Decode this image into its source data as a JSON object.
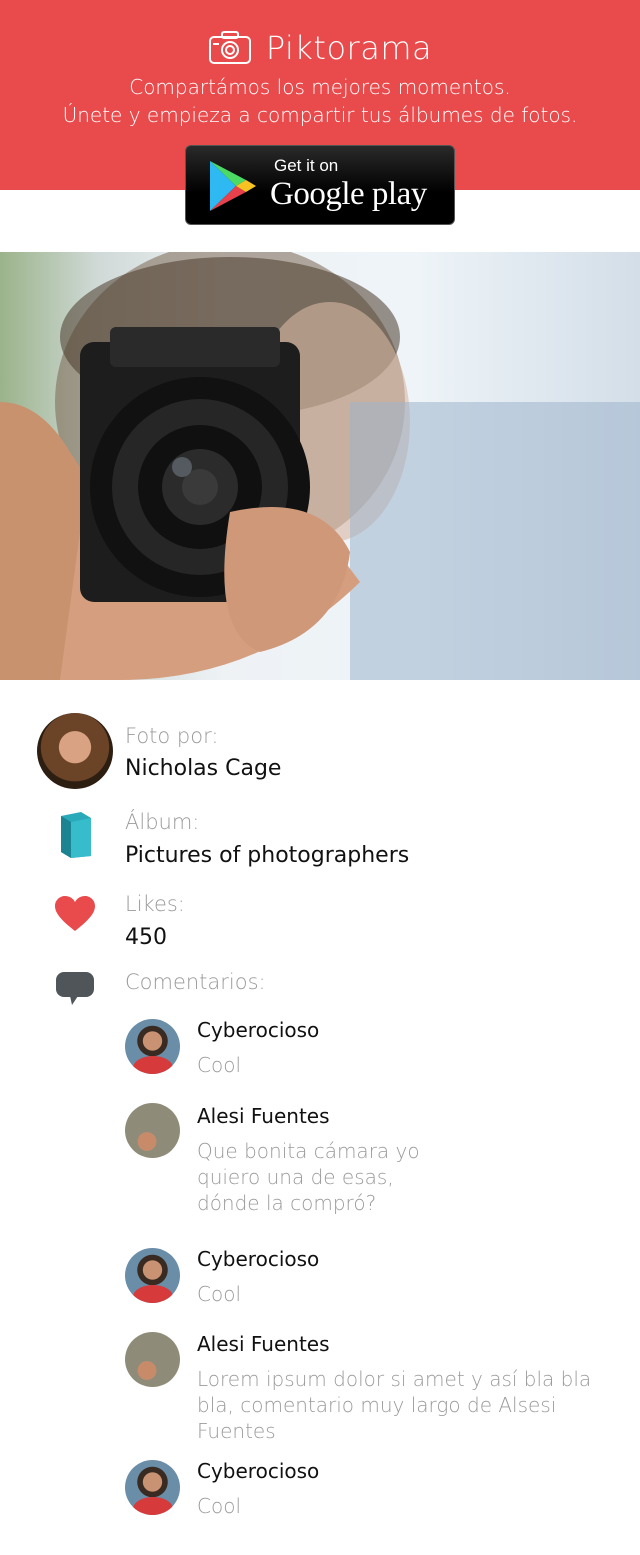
{
  "header": {
    "brand": "Piktorama",
    "tagline_line1": "Compartámos los mejores momentos.",
    "tagline_line2": "Únete y empieza a compartir tus álbumes de fotos.",
    "badge_top": "Get it on",
    "badge_bottom": "Google play",
    "accent_color": "#e94a4c"
  },
  "photo": {
    "icon": "photo-of-photographer-with-camera"
  },
  "info": {
    "author_label": "Foto por:",
    "author_name": "Nicholas Cage",
    "album_label": "Álbum:",
    "album_name": "Pictures of photographers",
    "likes_label": "Likes:",
    "likes_count": "450",
    "comments_label": "Comentarios:"
  },
  "comments": [
    {
      "author": "Cyberocioso",
      "text": [
        "Cool"
      ]
    },
    {
      "author": "Alesi Fuentes",
      "text": [
        "Que bonita cámara yo",
        "quiero una de esas,",
        "dónde la compró?"
      ]
    },
    {
      "author": "Cyberocioso",
      "text": [
        "Cool"
      ]
    },
    {
      "author": "Alesi Fuentes",
      "text": [
        "Lorem ipsum dolor si amet y así bla bla",
        "bla, comentario muy largo de Alsesi",
        "Fuentes"
      ]
    },
    {
      "author": "Cyberocioso",
      "text": [
        "Cool"
      ]
    }
  ]
}
